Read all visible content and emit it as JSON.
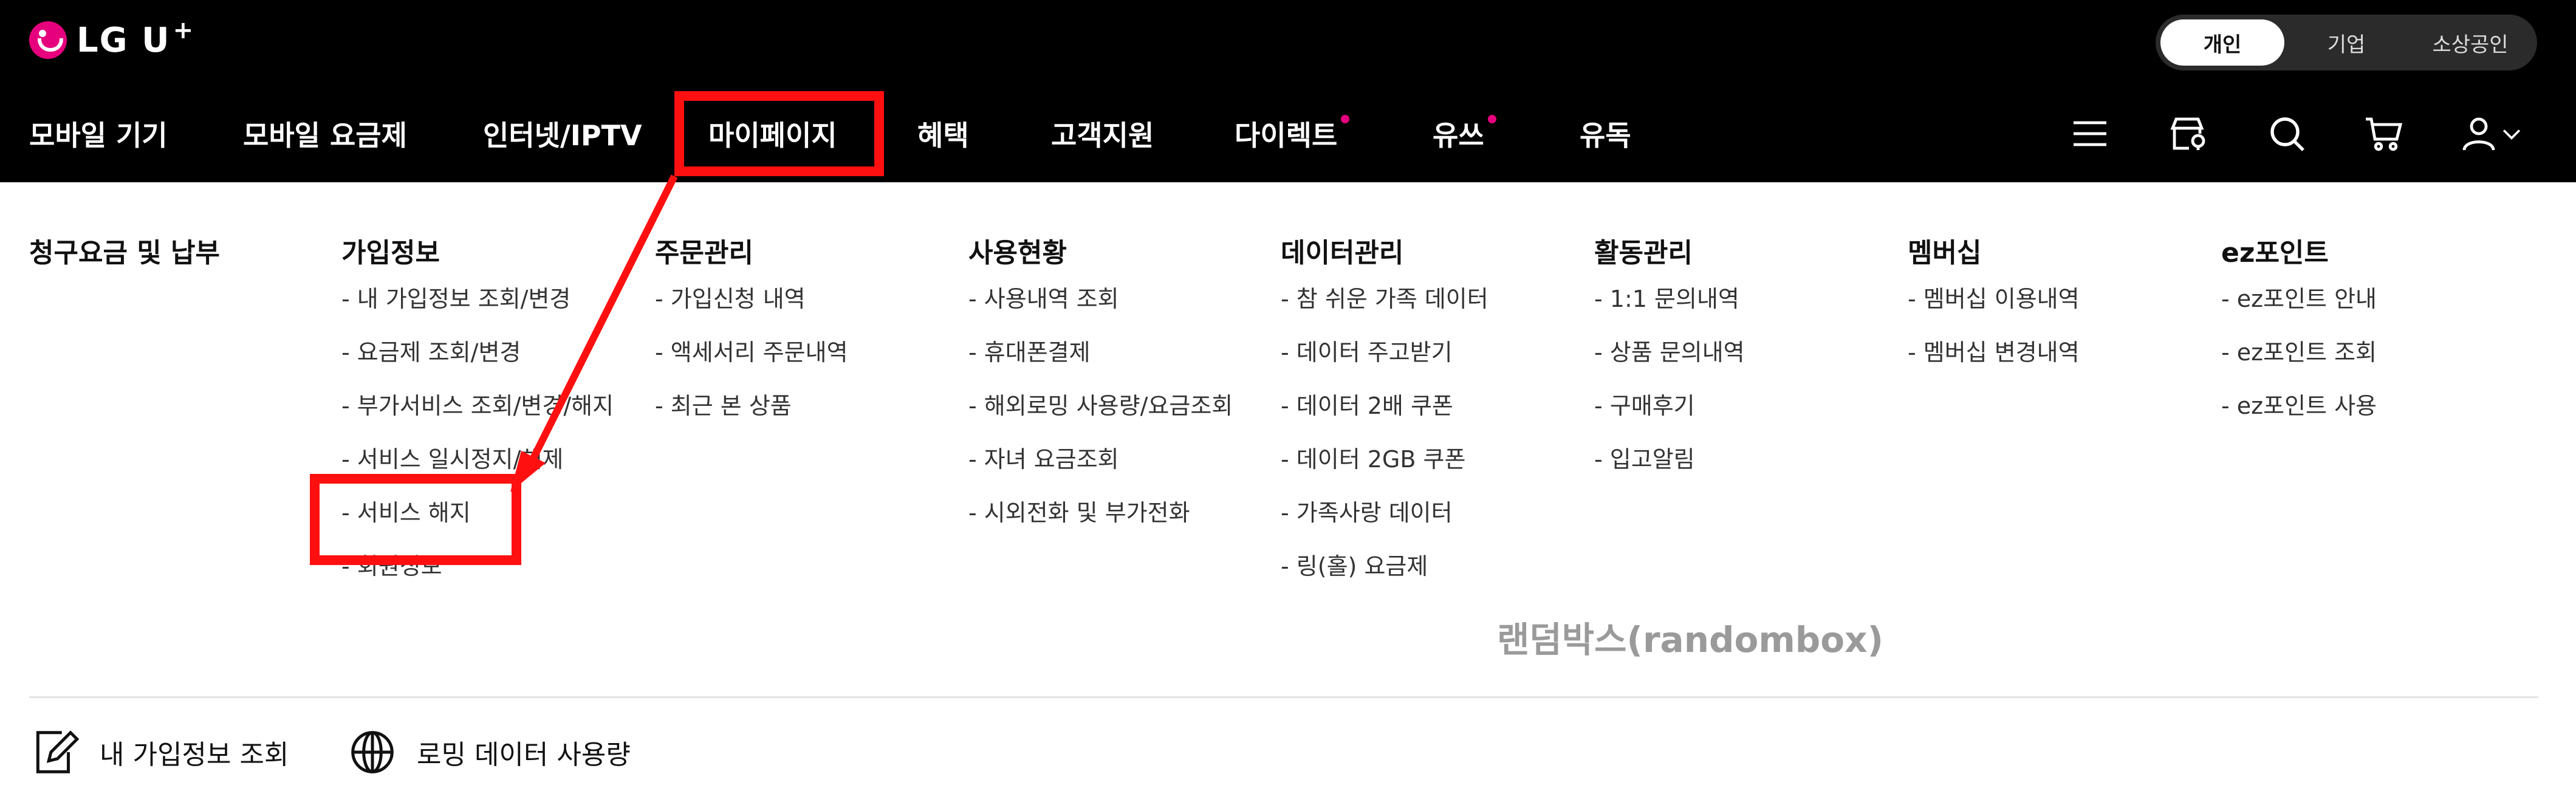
{
  "brand": {
    "logo_text": "LG U",
    "logo_plus": "+"
  },
  "segment": {
    "items": [
      "개인",
      "기업",
      "소상공인"
    ],
    "active": "개인"
  },
  "nav": {
    "items": [
      {
        "label": "모바일 기기",
        "dot": false
      },
      {
        "label": "모바일 요금제",
        "dot": false
      },
      {
        "label": "인터넷/IPTV",
        "dot": false
      },
      {
        "label": "마이페이지",
        "dot": false
      },
      {
        "label": "혜택",
        "dot": false
      },
      {
        "label": "고객지원",
        "dot": false
      },
      {
        "label": "다이렉트",
        "dot": true
      },
      {
        "label": "유쓰",
        "dot": true
      },
      {
        "label": "유독",
        "dot": false
      }
    ],
    "icons": [
      "menu-icon",
      "store-icon",
      "search-icon",
      "cart-icon",
      "user-icon",
      "chevron-down-icon"
    ],
    "accent_color": "#e6007e"
  },
  "menu": {
    "columns": [
      {
        "title": "청구요금 및 납부",
        "items": []
      },
      {
        "title": "가입정보",
        "items": [
          "- 내 가입정보 조회/변경",
          "- 요금제 조회/변경",
          "- 부가서비스 조회/변경/해지",
          "- 서비스 일시정지/해제",
          "- 서비스 해지",
          "- 회원정보"
        ]
      },
      {
        "title": "주문관리",
        "items": [
          "- 가입신청 내역",
          "- 액세서리 주문내역",
          "- 최근 본 상품"
        ]
      },
      {
        "title": "사용현황",
        "items": [
          "- 사용내역 조회",
          "- 휴대폰결제",
          "- 해외로밍 사용량/요금조회",
          "- 자녀 요금조회",
          "- 시외전화 및 부가전화"
        ]
      },
      {
        "title": "데이터관리",
        "items": [
          "- 참 쉬운 가족 데이터",
          "- 데이터 주고받기",
          "- 데이터 2배 쿠폰",
          "- 데이터 2GB 쿠폰",
          "- 가족사랑 데이터",
          "- 링(홀) 요금제"
        ]
      },
      {
        "title": "활동관리",
        "items": [
          "- 1:1 문의내역",
          "- 상품 문의내역",
          "- 구매후기",
          "- 입고알림"
        ]
      },
      {
        "title": "멤버십",
        "items": [
          "- 멤버십 이용내역",
          "- 멤버십 변경내역"
        ]
      },
      {
        "title": "ez포인트",
        "items": [
          "- ez포인트 안내",
          "- ez포인트 조회",
          "- ez포인트 사용"
        ]
      }
    ],
    "random_box": "랜덤박스(randombox)"
  },
  "quick_links": [
    {
      "label": "내 가입정보 조회",
      "icon": "edit-document-icon"
    },
    {
      "label": "로밍 데이터 사용량",
      "icon": "globe-icon"
    }
  ],
  "annotation_color": "#ff1010"
}
